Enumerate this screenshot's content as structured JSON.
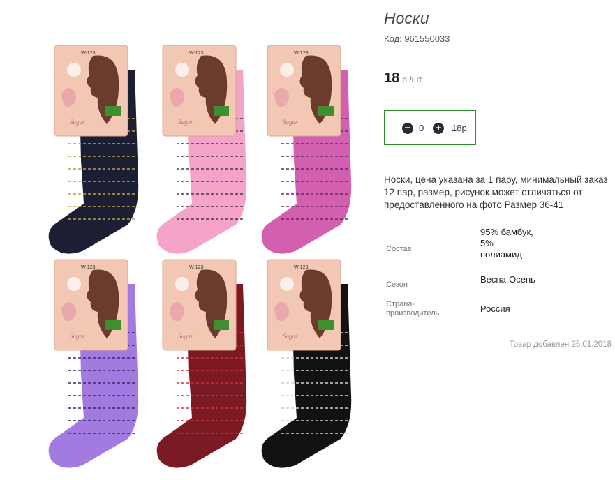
{
  "product": {
    "title": "Носки",
    "code": "Код: 961550033",
    "price_value": "18",
    "price_unit": "р./шт.",
    "description": "Носки, цена указана за 1 пару, минимальный заказ 12 пар, размер, рисунок может отличаться от предоставленного на фото Размер 36-41",
    "added": "Товар добавлен 25.01.2018"
  },
  "cart": {
    "minus_label": "−",
    "plus_label": "+",
    "quantity": "0",
    "total": "18р."
  },
  "photo": {
    "tag_text": "W-123",
    "brand_text": "Sugar",
    "socks": [
      {
        "color": "#1c1f33",
        "stitch": "#b8a24a"
      },
      {
        "color": "#f5a3c8",
        "stitch": "#4a3a4a"
      },
      {
        "color": "#d35fb0",
        "stitch": "#6a2a60"
      },
      {
        "color": "#a27ae0",
        "stitch": "#3a2a6a"
      },
      {
        "color": "#7c1a24",
        "stitch": "#d0303a"
      },
      {
        "color": "#121212",
        "stitch": "#cfcfcf"
      }
    ]
  },
  "properties": [
    {
      "label": "Состав",
      "value": "95% бамбук, 5% полиамид"
    },
    {
      "label": "Сезон",
      "value": "Весна-Осень"
    },
    {
      "label": "Страна-производитель",
      "value": "Россия"
    }
  ],
  "colors": {
    "accent": "#2f8f2f"
  }
}
